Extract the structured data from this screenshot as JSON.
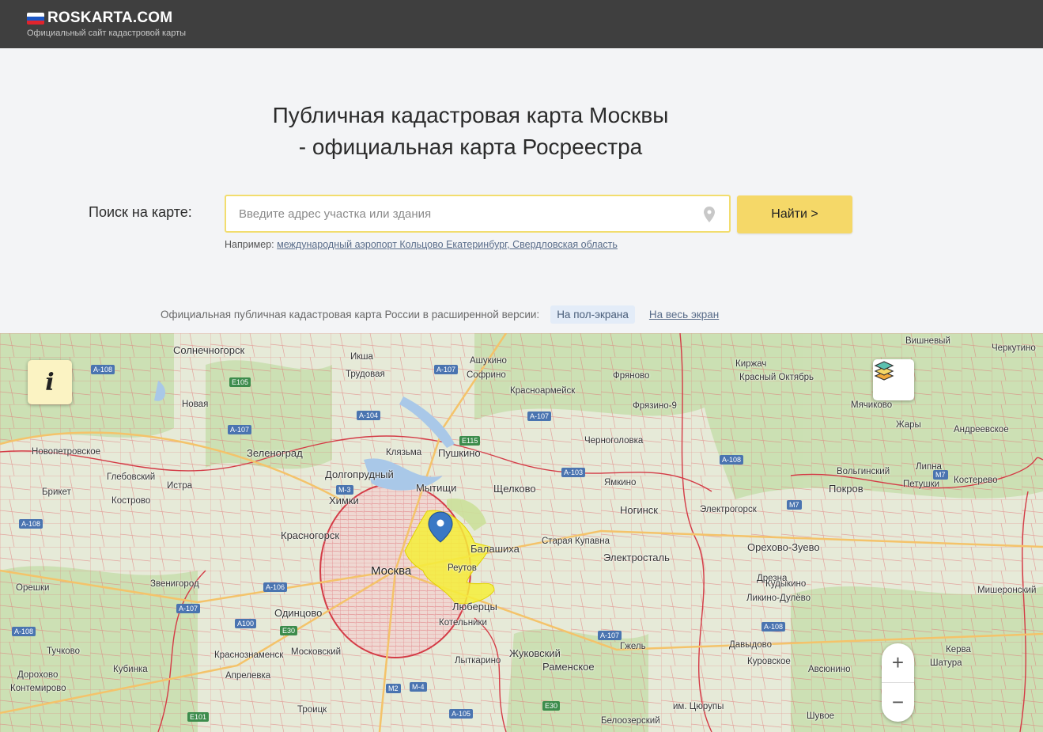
{
  "header": {
    "logo_text": "ROSKARTA.COM",
    "tagline": "Официальный сайт кадастровой карты",
    "flag_colors": [
      "#ffffff",
      "#1c57c4",
      "#e0242c"
    ]
  },
  "hero": {
    "title_line1": "Публичная кадастровая карта Москвы",
    "title_line2": "- официальная карта Росреестра"
  },
  "search": {
    "label": "Поиск на карте:",
    "placeholder": "Введите адрес участка или здания",
    "value": "",
    "button_label": "Найти >",
    "example_prefix": "Например:",
    "example_link": "международный аэропорт Кольцово Екатеринбург, Свердловская область"
  },
  "view_modes": {
    "text": "Официальная публичная кадастровая карта России в расширенной версии:",
    "option_active": "На пол-экрана",
    "option_link": "На весь экран"
  },
  "map": {
    "info_icon": "info-icon",
    "layers_icon": "layers-icon",
    "zoom_in": "+",
    "zoom_out": "−",
    "colors": {
      "parcel_lines": "#e0454f",
      "highlight": "#f5ef3a",
      "marker": "#3a78c5",
      "base": "#e8ecde"
    },
    "labels": {
      "moskva": "Москва",
      "solnechnogorsk": "Солнечногорск",
      "zelenograd": "Зеленоград",
      "dolgoprudny": "Долгопрудный",
      "khimki": "Химки",
      "mytishchi": "Мытищи",
      "pushkino": "Пушкино",
      "shchelkovo": "Щелково",
      "krasnogorsk": "Красногорск",
      "balashikha": "Балашиха",
      "staraya_kupavna": "Старая Купавна",
      "noginsk": "Ногинск",
      "elektrostal": "Электросталь",
      "elektrogorsk": "Электрогорск",
      "orekhovo": "Орехово-Зуево",
      "lyubertsy": "Люберцы",
      "kotelniki": "Котельники",
      "odintsovo": "Одинцово",
      "zvenigorod": "Звенигород",
      "istra": "Истра",
      "novaya": "Новая",
      "glebovsky": "Глебовский",
      "novopetrovskoe": "Новопетровское",
      "kostrovo": "Кострово",
      "briket": "Брикет",
      "oreshki": "Орешки",
      "tuchkovo": "Тучково",
      "kubinka": "Кубинка",
      "dorokhovo": "Дорохово",
      "kontemirovo": "Контемирово",
      "krasnoznamensk": "Краснознаменск",
      "moskovsky": "Московский",
      "aprelevka": "Апрелевка",
      "troitsk": "Троицк",
      "lytkarino": "Лыткарино",
      "zhukovsky": "Жуковский",
      "ramenskoe": "Раменское",
      "iksha": "Икша",
      "trudovaya": "Трудовая",
      "ashukino": "Ашукино",
      "sofrino": "Софрино",
      "krasnoarmeysk": "Красноармейск",
      "fryanovo": "Фряново",
      "fryazino": "Фрязино-9",
      "chernogolovka": "Черноголовка",
      "yamkino": "Ямкино",
      "kirzhach": "Киржач",
      "krasny_oktyabr": "Красный Октябрь",
      "myachikovo": "Мячиково",
      "zhary": "Жары",
      "andreevskoe": "Андреевское",
      "volginsky": "Вольгинский",
      "lipna": "Липна",
      "kosterevo": "Костерево",
      "petushki": "Петушки",
      "pokrov": "Покров",
      "vishnevy": "Вишневый",
      "cherkutino": "Черкутино",
      "gzhel": "Гжель",
      "kurovskoe": "Куровское",
      "likino": "Ликино-Дулёво",
      "kudykino": "Кудыкино",
      "dresna": "Дрезна",
      "davydovo": "Давыдово",
      "misherontsky": "Мишеронский",
      "kerva": "Керва",
      "shatura": "Шатура",
      "shuvoe": "Шувое",
      "avsyunino": "Авсюнино",
      "beloozersky": "Белоозерский",
      "tsyurupy": "им. Цюрупы",
      "klyazma": "Клязьма",
      "reutov": "Реутов"
    },
    "highways": {
      "a108_1": "A-108",
      "e105": "E105",
      "a107_1": "A-107",
      "a104": "A-104",
      "a107_2": "A-107",
      "e115": "E115",
      "a103": "A-103",
      "m3": "M-3",
      "a107_3": "A-107",
      "a108_2": "A-108",
      "m7": "M7",
      "m7b": "M7",
      "a108_3": "A-108",
      "a106": "A-106",
      "a107_4": "A-107",
      "a108_4": "A-108",
      "a100": "A100",
      "e30": "E30",
      "a107_5": "A-107",
      "a108_5": "A-108",
      "m4": "M-4",
      "m2": "M2",
      "a105": "A-105",
      "e30b": "E30",
      "e101": "E101"
    }
  }
}
